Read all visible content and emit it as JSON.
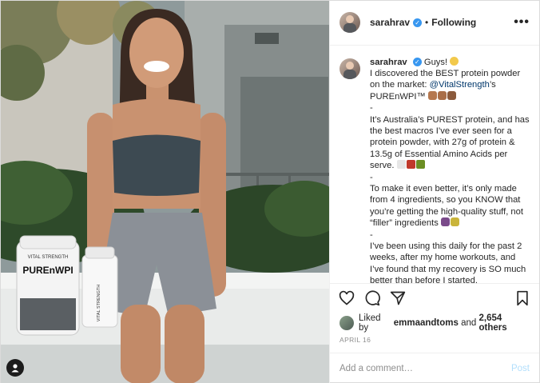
{
  "post": {
    "username": "sarahrav",
    "separator": "•",
    "follow_status": "Following",
    "more_label": "•••"
  },
  "caption": {
    "username": "sarahrav",
    "line1": "Guys!",
    "line2": "I discovered the BEST protein powder on the market:",
    "mention": "@VitalStrength",
    "line3": "’s PURE",
    "product_suffix": "nWPI™",
    "sep1": "-",
    "para2": "It’s Australia’s PUREST protein, and has the best macros I’ve ever seen for a protein powder, with 27g of protein & 13.5g of Essential Amino Acids per serve.",
    "sep2": "-",
    "para3": "To make it even better, it’s only made from 4 ingredients, so you KNOW that you’re getting the high-quality stuff, not “filler” ingredients",
    "sep3": "-",
    "para4": "I’ve been using this daily for the past 2 weeks, after my home workouts, and I’ve found that my recovery is SO much better than before I started."
  },
  "likes": {
    "prefix": "Liked by",
    "user": "emmaandtoms",
    "middle": "and",
    "count": "2,654 others"
  },
  "date": "APRIL 16",
  "comment_box": {
    "placeholder": "Add a comment…",
    "post_label": "Post"
  },
  "photo": {
    "tub_brand": "VITAL STRENGTH",
    "tub_product": "PUREnWPI",
    "shaker_brand": "VITAL STRENGTH"
  },
  "icons": {
    "verified": "verified-badge-icon",
    "like": "heart-icon",
    "comment": "comment-bubble-icon",
    "share": "paper-plane-icon",
    "save": "bookmark-icon",
    "tag": "person-tag-icon"
  },
  "colors": {
    "verified": "#3897f0",
    "mention": "#00376b",
    "post_disabled": "#b2dffc",
    "muted": "#8e8e8e"
  }
}
